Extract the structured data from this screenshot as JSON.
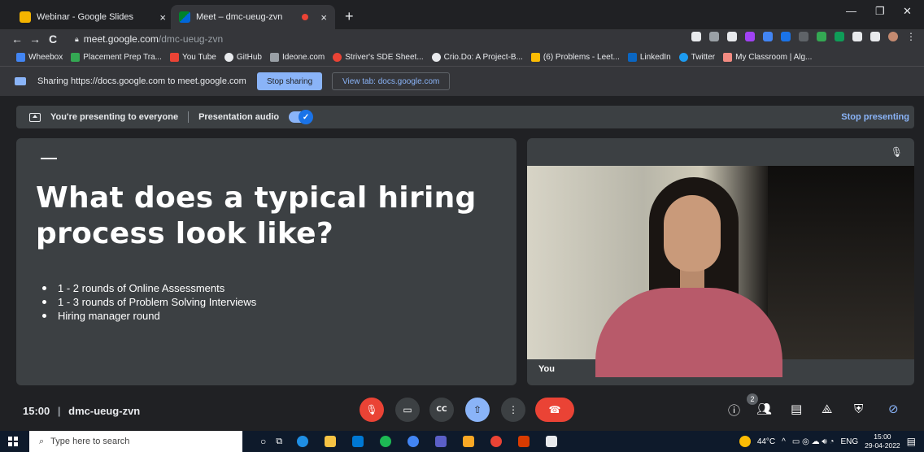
{
  "browser": {
    "tabs": [
      {
        "title": "Webinar - Google Slides",
        "close": "×"
      },
      {
        "title": "Meet – dmc-ueug-zvn",
        "close": "×"
      }
    ],
    "new_tab": "+",
    "window_controls": {
      "minimize": "—",
      "restore": "❐",
      "close": "✕"
    },
    "address": {
      "host": "meet.google.com",
      "path": "/dmc-ueug-zvn"
    },
    "nav": {
      "back": "←",
      "forward": "→",
      "reload": "C"
    }
  },
  "bookmarks": [
    "Wheebox",
    "Placement Prep Tra...",
    "You Tube",
    "GitHub",
    "Ideone.com",
    "Striver's SDE Sheet...",
    "Crio.Do: A Project-B...",
    "(6) Problems - Leet...",
    "LinkedIn",
    "Twitter",
    "My Classroom | Alg..."
  ],
  "share_bar": {
    "message": "Sharing https://docs.google.com to meet.google.com",
    "stop_sharing": "Stop sharing",
    "view_tab": "View tab: docs.google.com"
  },
  "presenting": {
    "status": "You're presenting to everyone",
    "audio_label": "Presentation audio",
    "stop": "Stop presenting"
  },
  "slide": {
    "dash": "—",
    "title": "What does a typical hiring process look like?",
    "bullets": [
      "1 - 2 rounds of Online Assessments",
      "1 - 3 rounds of Problem Solving Interviews",
      "Hiring manager round"
    ]
  },
  "self_view": {
    "name": "You"
  },
  "meeting": {
    "time": "15:00",
    "divider": "|",
    "code": "dmc-ueug-zvn",
    "participant_count": "2"
  },
  "taskbar": {
    "search_placeholder": "Type here to search",
    "temperature": "44°C",
    "language": "ENG",
    "time": "15:00",
    "date": "29-04-2022"
  },
  "colors": {
    "accent": "#8ab4f8",
    "hangup": "#ea4335",
    "surface": "#3c4043",
    "background": "#202124"
  }
}
